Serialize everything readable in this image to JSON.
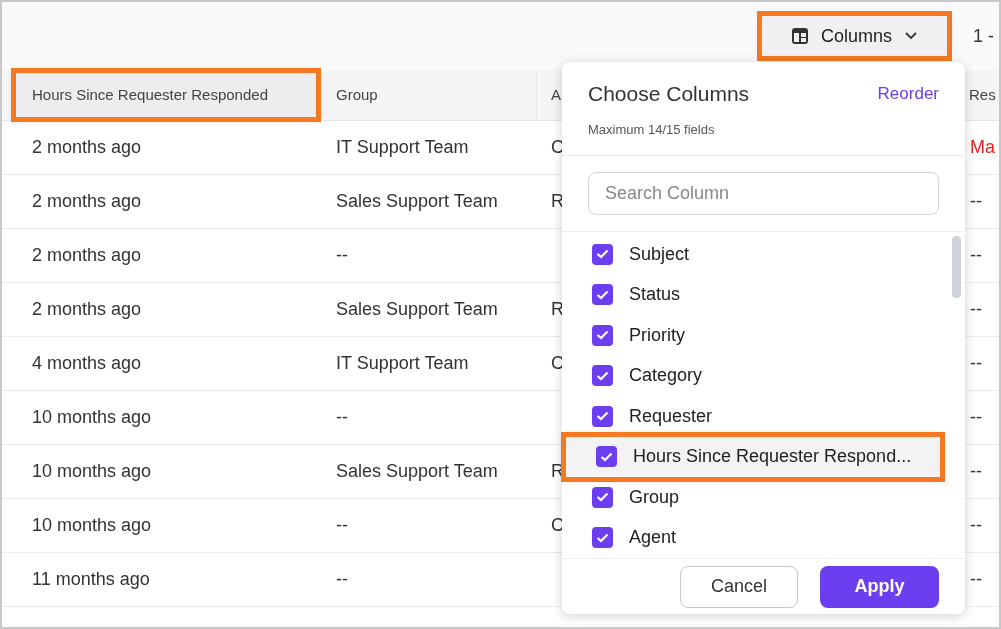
{
  "toolbar": {
    "columns_button": {
      "label": "Columns",
      "highlighted": true
    },
    "pagination": "1 -"
  },
  "table": {
    "columns": [
      {
        "label": "Hours Since Requester Responded",
        "highlighted": true
      },
      {
        "label": "Group",
        "highlighted": false
      },
      {
        "label": "A",
        "highlighted": false
      },
      {
        "label": "Res",
        "highlighted": false
      }
    ],
    "rows": [
      {
        "hours": "2 months ago",
        "group": "IT Support Team",
        "column_3": "C",
        "column_4": "Ma",
        "overdue": true
      },
      {
        "hours": "2 months ago",
        "group": "Sales Support Team",
        "column_3": "R",
        "column_4": "--",
        "overdue": false
      },
      {
        "hours": "2 months ago",
        "group": "--",
        "column_4": "--",
        "overdue": false
      },
      {
        "hours": "2 months ago",
        "group": "Sales Support Team",
        "column_3": "R",
        "column_4": "--",
        "overdue": false
      },
      {
        "hours": "4 months ago",
        "group": "IT Support Team",
        "column_3": "C",
        "column_4": "--",
        "overdue": false
      },
      {
        "hours": "10 months ago",
        "group": "--",
        "column_4": "--",
        "overdue": false
      },
      {
        "hours": "10 months ago",
        "group": "Sales Support Team",
        "column_3": "R",
        "column_4": "--",
        "overdue": false
      },
      {
        "hours": "10 months ago",
        "group": "--",
        "column_3": "C",
        "column_4": "--",
        "overdue": false
      },
      {
        "hours": "11 months ago",
        "group": "--",
        "column_4": "--",
        "overdue": false
      }
    ]
  },
  "popup": {
    "title": "Choose Columns",
    "reorder": "Reorder",
    "subtitle": "Maximum 14/15 fields",
    "search": {
      "placeholder": "Search Column"
    },
    "items": [
      {
        "label": "Subject",
        "checked": true,
        "highlighted": false
      },
      {
        "label": "Status",
        "checked": true,
        "highlighted": false
      },
      {
        "label": "Priority",
        "checked": true,
        "highlighted": false
      },
      {
        "label": "Category",
        "checked": true,
        "highlighted": false
      },
      {
        "label": "Requester",
        "checked": true,
        "highlighted": false
      },
      {
        "label": "Hours Since Requester Respond...",
        "checked": true,
        "highlighted": true
      },
      {
        "label": "Group",
        "checked": true,
        "highlighted": false
      },
      {
        "label": "Agent",
        "checked": true,
        "highlighted": false
      }
    ],
    "buttons": [
      {
        "kind": "secondary",
        "label": "Cancel"
      },
      {
        "kind": "primary",
        "label": "Apply"
      }
    ]
  }
}
